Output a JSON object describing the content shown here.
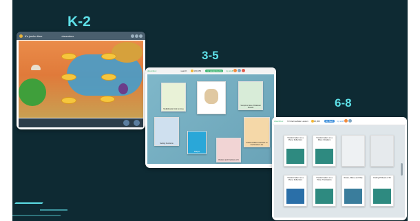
{
  "grades": {
    "k2": "K-2",
    "g35": "3-5",
    "g68": "6-8"
  },
  "k2_screen": {
    "title": "it's jumbo time",
    "logo": "dreambox"
  },
  "g35_screen": {
    "logo": "dreambox",
    "search": "search",
    "coins": "160,056",
    "my_button": "my assignments",
    "my_stuff": "my stuff",
    "cards": [
      "Multiplication Grid on Area",
      "Vampire's Side of Rational Sounds",
      "Setting Functions",
      "Fractions Bars Functions on the Number Line",
      "Shapes",
      "Division and Fractions of it"
    ]
  },
  "g68_screen": {
    "logo": "dreambox",
    "welcome": "hi Intermediate Lesson",
    "coins": "10,000",
    "my_button": "My Stuff",
    "my_stuff": "my stuff",
    "cards": [
      "Transformations on a Plane: Reflections",
      "Transformations on a Plane: Rotations",
      "",
      "",
      "Transformations on a Plane: Reflections",
      "Transformations on a Plane: Translations",
      "Rotate, Slides, and Flips",
      "Finding Pi Means of Fit"
    ]
  },
  "colors": {
    "background": "#0e2a33",
    "grade_label": "#5ee0e8",
    "accent_green": "#3ab26e"
  }
}
